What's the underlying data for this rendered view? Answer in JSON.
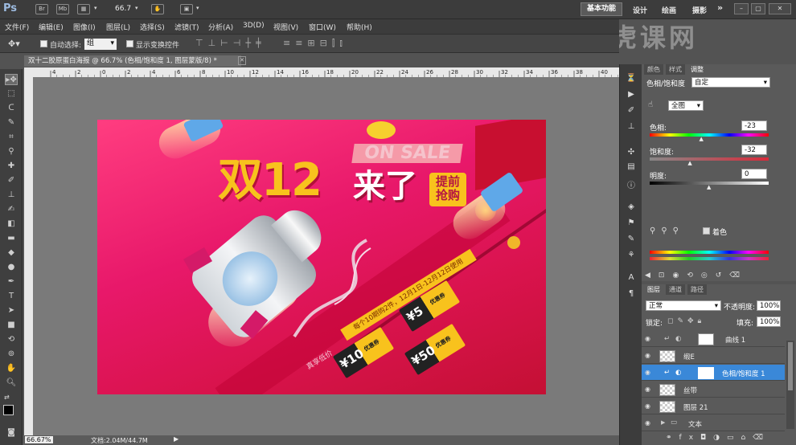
{
  "app": {
    "logo": "Ps"
  },
  "topbar": {
    "zoom": "66.7",
    "workspaces": {
      "essentials": "基本功能",
      "design": "设计",
      "painting": "绘画",
      "photography": "摄影"
    },
    "more": "»"
  },
  "menu": [
    "文件(F)",
    "编辑(E)",
    "图像(I)",
    "图层(L)",
    "选择(S)",
    "滤镜(T)",
    "分析(A)",
    "3D(D)",
    "视图(V)",
    "窗口(W)",
    "帮助(H)"
  ],
  "options": {
    "auto_select_label": "自动选择:",
    "auto_select_value": "组",
    "show_transform_label": "显示变换控件"
  },
  "document": {
    "tab_title": "双十二胶原蛋白海报 @ 66.7% (色相/饱和度 1, 图层蒙版/8) *",
    "ruler_ticks": [
      "4",
      "2",
      "0",
      "2",
      "4",
      "6",
      "8",
      "10",
      "12",
      "14",
      "16",
      "18",
      "20",
      "22",
      "24",
      "26",
      "28",
      "30",
      "32",
      "34",
      "36",
      "38",
      "40"
    ]
  },
  "poster": {
    "title_num": "双12",
    "title_text": "来了",
    "badge": "提前\n抢购",
    "on_sale": "ON SALE",
    "ribbon": "每个10期购2件，12月1日-12月12日使用",
    "small_text": "真享低价",
    "coupons": [
      "¥5",
      "¥10",
      "¥50"
    ],
    "coupon_label": "优惠券"
  },
  "status": {
    "zoom": "66.67%",
    "doc": "文档:2.04M/44.7M"
  },
  "adjustments": {
    "tabs": [
      "颜色",
      "样式",
      "调整"
    ],
    "title": "色相/饱和度",
    "preset": "自定",
    "channel": "全图",
    "hue_label": "色相:",
    "hue_value": "-23",
    "sat_label": "饱和度:",
    "sat_value": "-32",
    "light_label": "明度:",
    "light_value": "0",
    "colorize": "着色"
  },
  "layers": {
    "tabs": [
      "图层",
      "通道",
      "路径"
    ],
    "blend_mode": "正常",
    "opacity_label": "不透明度:",
    "opacity_value": "100%",
    "lock_label": "锁定:",
    "fill_label": "填充:",
    "fill_value": "100%",
    "items": [
      {
        "name": "曲线 1"
      },
      {
        "name": "缎E"
      },
      {
        "name": "色相/饱和度 1"
      },
      {
        "name": "丝带"
      },
      {
        "name": "图层 21"
      },
      {
        "name": "文本"
      }
    ]
  },
  "colors": {
    "accent": "#3a88d8",
    "poster_red": "#d9134d",
    "title_yellow": "#fbc02d"
  }
}
